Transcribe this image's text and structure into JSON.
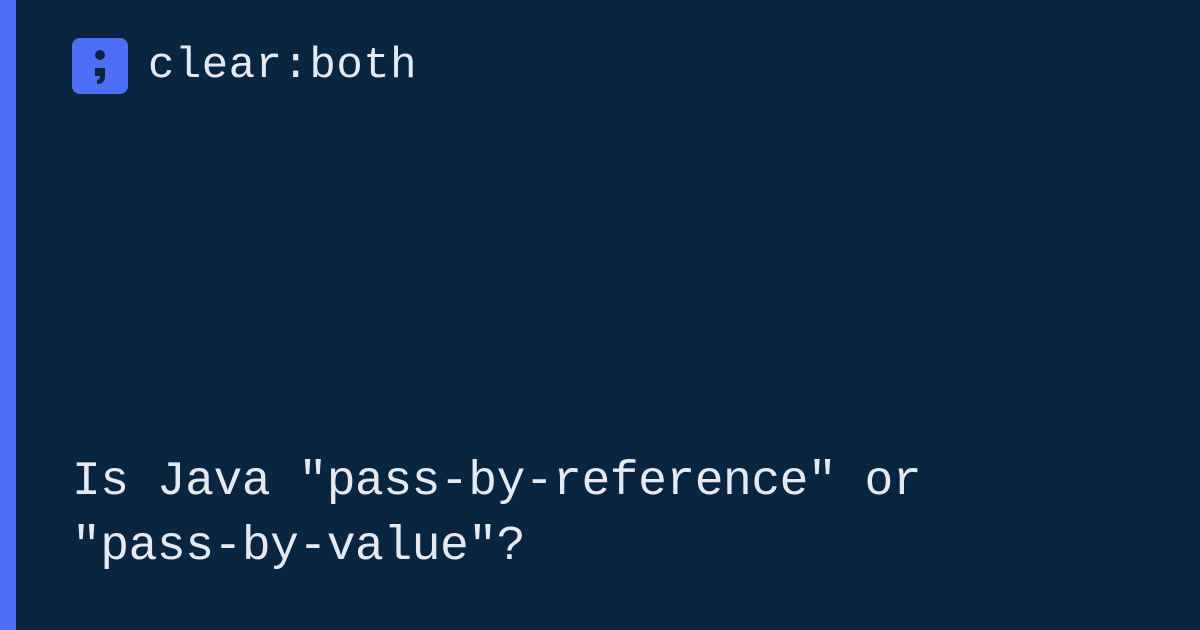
{
  "brand": {
    "name": "clear:both"
  },
  "title": "Is Java \"pass-by-reference\" or \"pass-by-value\"?",
  "colors": {
    "accent": "#4f6ef7",
    "background": "#0a2540",
    "text": "#e6e9f0"
  }
}
